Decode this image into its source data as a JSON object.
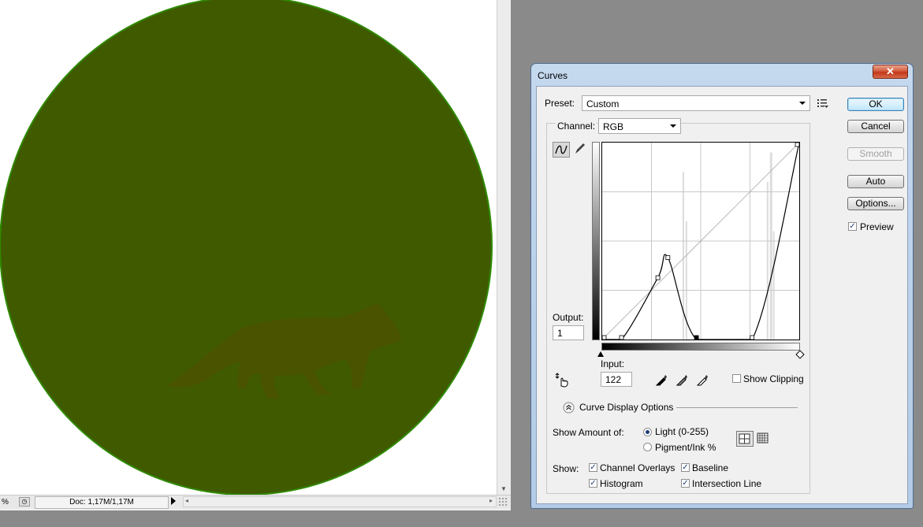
{
  "document": {
    "zoom": "%",
    "doc_info": "Doc: 1,17M/1,17M"
  },
  "curves": {
    "title": "Curves",
    "close_label": "✕",
    "preset_label": "Preset:",
    "preset_value": "Custom",
    "channel_label": "Channel:",
    "channel_value": "RGB",
    "output_label": "Output:",
    "output_value": "1",
    "input_label": "Input:",
    "input_value": "122",
    "show_clipping": "Show Clipping",
    "show_clipping_checked": false,
    "display_options_label": "Curve Display Options",
    "show_amount_label": "Show Amount of:",
    "light_label": "Light  (0-255)",
    "pigment_label": "Pigment/Ink %",
    "light_selected": true,
    "show_label": "Show:",
    "channel_overlays": "Channel Overlays",
    "baseline": "Baseline",
    "histogram": "Histogram",
    "intersection_line": "Intersection Line",
    "channel_overlays_checked": true,
    "baseline_checked": true,
    "histogram_checked": true,
    "intersection_line_checked": true,
    "curve_points": [
      [
        0,
        0
      ],
      [
        25,
        0
      ],
      [
        72,
        80
      ],
      [
        85,
        106
      ],
      [
        122,
        0
      ],
      [
        194,
        0
      ],
      [
        255,
        255
      ]
    ]
  },
  "buttons": {
    "ok": "OK",
    "cancel": "Cancel",
    "smooth": "Smooth",
    "auto": "Auto",
    "options": "Options...",
    "preview": "Preview",
    "preview_checked": true
  },
  "colors": {
    "circle_fill": "#405a00",
    "circle_edge": "#2f8a00",
    "fox": "#4a5300"
  },
  "icons": {
    "curve_tool": "curve-icon",
    "pencil_tool": "pencil-icon",
    "hand_tool": "target-adjust-icon",
    "eyedroppers": [
      "black-eyedropper-icon",
      "gray-eyedropper-icon",
      "white-eyedropper-icon"
    ],
    "preset_menu": "preset-menu-icon",
    "grid_simple": "grid-4-icon",
    "grid_detailed": "grid-10-icon"
  }
}
